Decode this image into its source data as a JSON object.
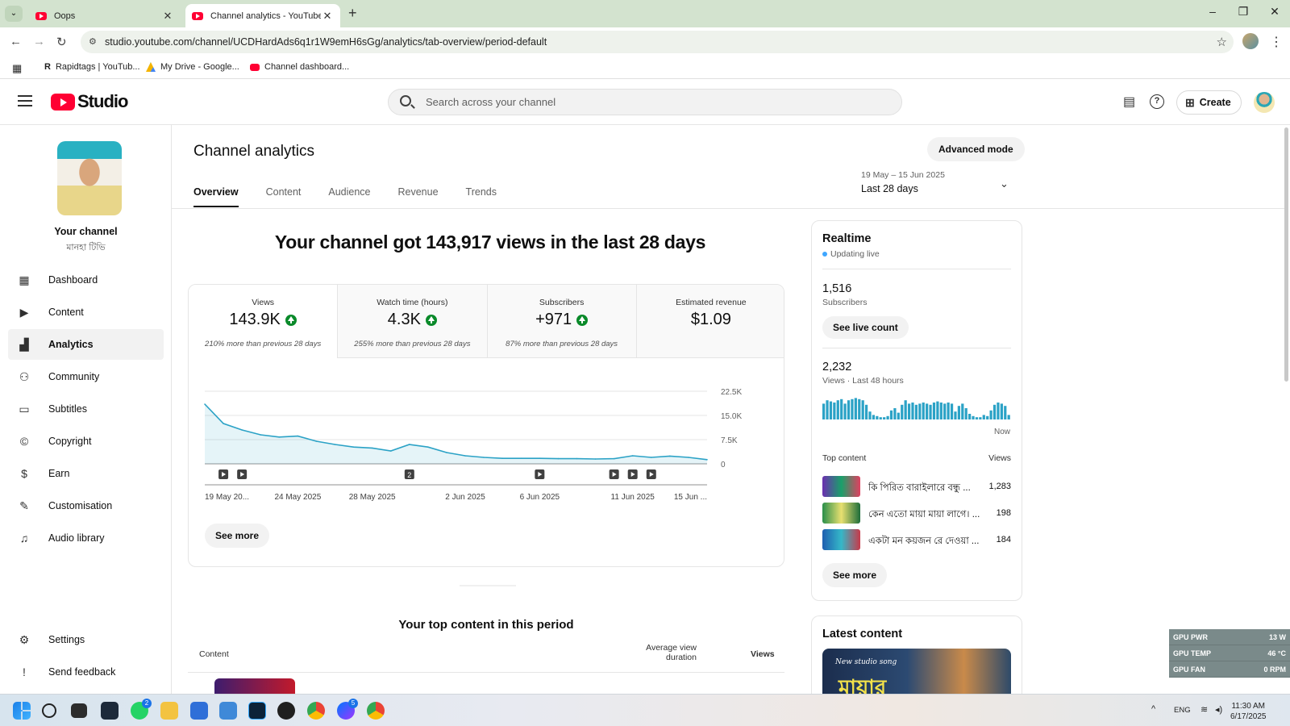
{
  "browser": {
    "tabs": [
      {
        "title": "Oops",
        "active": false
      },
      {
        "title": "Channel analytics - YouTube Studio",
        "active": true
      }
    ],
    "url": "studio.youtube.com/channel/UCDHardAds6q1r1W9emH6sGg/analytics/tab-overview/period-default",
    "bookmarks": [
      {
        "label": "Rapidtags | YouTub..."
      },
      {
        "label": "My Drive - Google..."
      },
      {
        "label": "Channel dashboard..."
      }
    ]
  },
  "header": {
    "logo_text": "Studio",
    "search_placeholder": "Search across your channel",
    "create_label": "Create"
  },
  "sidebar": {
    "channel_title": "Your channel",
    "channel_name": "মানহা টিভি",
    "items": [
      {
        "label": "Dashboard",
        "icon": "dashboard-icon"
      },
      {
        "label": "Content",
        "icon": "content-icon"
      },
      {
        "label": "Analytics",
        "icon": "analytics-icon",
        "active": true
      },
      {
        "label": "Community",
        "icon": "community-icon"
      },
      {
        "label": "Subtitles",
        "icon": "subtitles-icon"
      },
      {
        "label": "Copyright",
        "icon": "copyright-icon"
      },
      {
        "label": "Earn",
        "icon": "earn-icon"
      },
      {
        "label": "Customisation",
        "icon": "customisation-icon"
      },
      {
        "label": "Audio library",
        "icon": "audio-library-icon"
      }
    ],
    "bottom_items": [
      {
        "label": "Settings",
        "icon": "settings-icon"
      },
      {
        "label": "Send feedback",
        "icon": "feedback-icon"
      }
    ]
  },
  "main": {
    "title": "Channel analytics",
    "advanced_mode": "Advanced mode",
    "tabs": [
      "Overview",
      "Content",
      "Audience",
      "Revenue",
      "Trends"
    ],
    "active_tab": "Overview",
    "date_range": "19 May – 15 Jun 2025",
    "period_label": "Last 28 days",
    "headline": "Your channel got 143,917 views in the last 28 days",
    "metrics": [
      {
        "label": "Views",
        "value": "143.9K",
        "up": true,
        "note": "210% more than previous 28 days"
      },
      {
        "label": "Watch time (hours)",
        "value": "4.3K",
        "up": true,
        "note": "255% more than previous 28 days"
      },
      {
        "label": "Subscribers",
        "value": "+971",
        "up": true,
        "note": "87% more than previous 28 days"
      },
      {
        "label": "Estimated revenue",
        "value": "$1.09",
        "up": false,
        "note": ""
      }
    ],
    "see_more": "See more",
    "top_content_title": "Your top content in this period",
    "top_content_cols": {
      "content": "Content",
      "avg_duration": "Average view duration",
      "views": "Views"
    }
  },
  "chart_data": {
    "type": "area",
    "x": [
      "19 May",
      "20 May",
      "21 May",
      "22 May",
      "23 May",
      "24 May",
      "25 May",
      "26 May",
      "27 May",
      "28 May",
      "29 May",
      "30 May",
      "31 May",
      "1 Jun",
      "2 Jun",
      "3 Jun",
      "4 Jun",
      "5 Jun",
      "6 Jun",
      "7 Jun",
      "8 Jun",
      "9 Jun",
      "10 Jun",
      "11 Jun",
      "12 Jun",
      "13 Jun",
      "14 Jun",
      "15 Jun"
    ],
    "values": [
      18500,
      12500,
      10500,
      9000,
      8300,
      8600,
      7000,
      6000,
      5200,
      4900,
      4000,
      6000,
      5200,
      3500,
      2500,
      2000,
      1700,
      1700,
      1700,
      1600,
      1600,
      1500,
      1600,
      2500,
      2000,
      2400,
      2000,
      1300
    ],
    "x_tick_labels": [
      "19 May 20...",
      "24 May 2025",
      "28 May 2025",
      "2 Jun 2025",
      "6 Jun 2025",
      "11 Jun 2025",
      "15 Jun ..."
    ],
    "x_tick_index": [
      0,
      5,
      9,
      14,
      18,
      23,
      27
    ],
    "y_ticks": [
      0,
      7500,
      15000,
      22500
    ],
    "y_tick_labels": [
      "0",
      "7.5K",
      "15.0K",
      "22.5K"
    ],
    "ylim": [
      0,
      22500
    ],
    "grid": true,
    "video_markers": [
      {
        "day_index": 1,
        "label": ""
      },
      {
        "day_index": 2,
        "label": ""
      },
      {
        "day_index": 11,
        "label": "2"
      },
      {
        "day_index": 18,
        "label": ""
      },
      {
        "day_index": 22,
        "label": ""
      },
      {
        "day_index": 23,
        "label": ""
      },
      {
        "day_index": 24,
        "label": ""
      }
    ],
    "color": "#2ba2c6"
  },
  "realtime": {
    "title": "Realtime",
    "status": "Updating live",
    "subscribers_value": "1,516",
    "subscribers_label": "Subscribers",
    "see_live": "See live count",
    "views_value": "2,232",
    "views_label": "Views · Last 48 hours",
    "now_label": "Now",
    "bars": [
      14,
      17,
      16,
      15,
      17,
      18,
      14,
      17,
      18,
      19,
      18,
      17,
      13,
      7,
      4,
      3,
      2,
      2,
      3,
      8,
      10,
      6,
      13,
      17,
      14,
      15,
      13,
      14,
      15,
      14,
      13,
      15,
      16,
      15,
      14,
      15,
      14,
      7,
      12,
      14,
      10,
      5,
      3,
      2,
      2,
      4,
      3,
      8,
      13,
      15,
      14,
      12,
      4
    ],
    "top_content_label": "Top content",
    "views_col": "Views",
    "top_items": [
      {
        "title": "কি পিরিত বারাইলারে বন্ধু ...",
        "views": "1,283"
      },
      {
        "title": "কেন এতো মায়া মায়া লাগে। ...",
        "views": "198"
      },
      {
        "title": "একটা মন কয়জন রে দেওয়া ...",
        "views": "184"
      }
    ],
    "see_more": "See more"
  },
  "latest": {
    "title": "Latest content",
    "thumb_small": "New studio song",
    "thumb_big": "মায়ার"
  },
  "gpu": [
    {
      "label": "GPU PWR",
      "value": "13 W"
    },
    {
      "label": "GPU TEMP",
      "value": "46 °C"
    },
    {
      "label": "GPU FAN",
      "value": "0 RPM"
    }
  ],
  "taskbar": {
    "lang": "ENG",
    "time": "11:30 AM",
    "date": "6/17/2025",
    "badges": {
      "whatsapp": "2",
      "messenger": "5"
    }
  },
  "colors": {
    "accent": "#2ba2c6",
    "brand": "#ff0033",
    "up": "#0a8a2a"
  }
}
